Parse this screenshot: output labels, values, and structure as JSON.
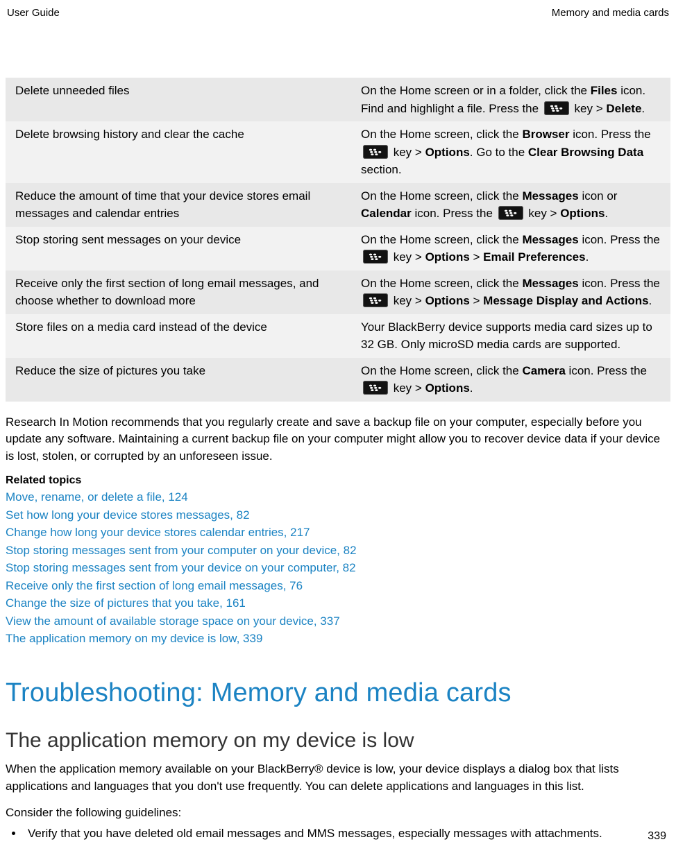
{
  "header": {
    "left": "User Guide",
    "right": "Memory and media cards"
  },
  "table": {
    "rows": [
      {
        "tip": "Delete unneeded files",
        "desc": {
          "parts": [
            {
              "t": "On the Home screen or in a folder, click the "
            },
            {
              "t": "Files",
              "b": true
            },
            {
              "t": " icon. Find and highlight a file. Press the "
            },
            {
              "icon": true
            },
            {
              "t": " key > "
            },
            {
              "t": "Delete",
              "b": true
            },
            {
              "t": "."
            }
          ]
        }
      },
      {
        "tip": "Delete browsing history and clear the cache",
        "desc": {
          "parts": [
            {
              "t": "On the Home screen, click the "
            },
            {
              "t": "Browser",
              "b": true
            },
            {
              "t": " icon. Press the "
            },
            {
              "icon": true
            },
            {
              "t": " key > "
            },
            {
              "t": "Options",
              "b": true
            },
            {
              "t": ". Go to the "
            },
            {
              "t": "Clear Browsing Data",
              "b": true
            },
            {
              "t": " section."
            }
          ]
        }
      },
      {
        "tip": "Reduce the amount of time that your device stores email messages and calendar entries",
        "desc": {
          "parts": [
            {
              "t": "On the Home screen, click the "
            },
            {
              "t": "Messages",
              "b": true
            },
            {
              "t": " icon or "
            },
            {
              "t": "Calendar",
              "b": true
            },
            {
              "t": " icon. Press the "
            },
            {
              "icon": true
            },
            {
              "t": " key > "
            },
            {
              "t": "Options",
              "b": true
            },
            {
              "t": "."
            }
          ]
        }
      },
      {
        "tip": "Stop storing sent messages on your device",
        "desc": {
          "parts": [
            {
              "t": "On the Home screen, click the "
            },
            {
              "t": "Messages",
              "b": true
            },
            {
              "t": " icon. Press the "
            },
            {
              "icon": true
            },
            {
              "t": " key > "
            },
            {
              "t": "Options",
              "b": true
            },
            {
              "t": " > "
            },
            {
              "t": "Email Preferences",
              "b": true
            },
            {
              "t": "."
            }
          ]
        }
      },
      {
        "tip": "Receive only the first section of long email messages, and choose whether to download more",
        "desc": {
          "parts": [
            {
              "t": "On the Home screen, click the "
            },
            {
              "t": "Messages",
              "b": true
            },
            {
              "t": " icon. Press the "
            },
            {
              "icon": true
            },
            {
              "t": " key > "
            },
            {
              "t": "Options",
              "b": true
            },
            {
              "t": " > "
            },
            {
              "t": "Message Display and Actions",
              "b": true
            },
            {
              "t": "."
            }
          ]
        }
      },
      {
        "tip": "Store files on a media card instead of the device",
        "desc": {
          "parts": [
            {
              "t": "Your BlackBerry device supports media card sizes up to 32 GB. Only microSD media cards are supported."
            }
          ]
        }
      },
      {
        "tip": "Reduce the size of pictures you take",
        "desc": {
          "parts": [
            {
              "t": "On the Home screen, click the "
            },
            {
              "t": "Camera",
              "b": true
            },
            {
              "t": " icon. Press the "
            },
            {
              "icon": true
            },
            {
              "t": " key > "
            },
            {
              "t": "Options",
              "b": true
            },
            {
              "t": "."
            }
          ]
        }
      }
    ]
  },
  "body_para": "Research In Motion recommends that you regularly create and save a backup file on your computer, especially before you update any software. Maintaining a current backup file on your computer might allow you to recover device data if your device is lost, stolen, or corrupted by an unforeseen issue.",
  "related": {
    "heading": "Related topics",
    "items": [
      "Move, rename, or delete a file, 124",
      "Set how long your device stores messages, 82",
      "Change how long your device stores calendar entries, 217",
      "Stop storing messages sent from your computer on your device, 82",
      "Stop storing messages sent from your device on your computer, 82",
      "Receive only the first section of long email messages, 76",
      "Change the size of pictures that you take, 161",
      "View the amount of available storage space on your device, 337",
      "The application memory on my device is low, 339"
    ]
  },
  "troubleshooting": {
    "title": "Troubleshooting: Memory and media cards",
    "subtitle": "The application memory on my device is low",
    "para1": "When the application memory available on your BlackBerry® device is low, your device displays a dialog box that lists applications and languages that you don't use frequently. You can delete applications and languages in this list.",
    "para2": "Consider the following guidelines:",
    "bullets": [
      "Verify that you have deleted old email messages and MMS messages, especially messages with attachments."
    ]
  },
  "page_number": "339"
}
